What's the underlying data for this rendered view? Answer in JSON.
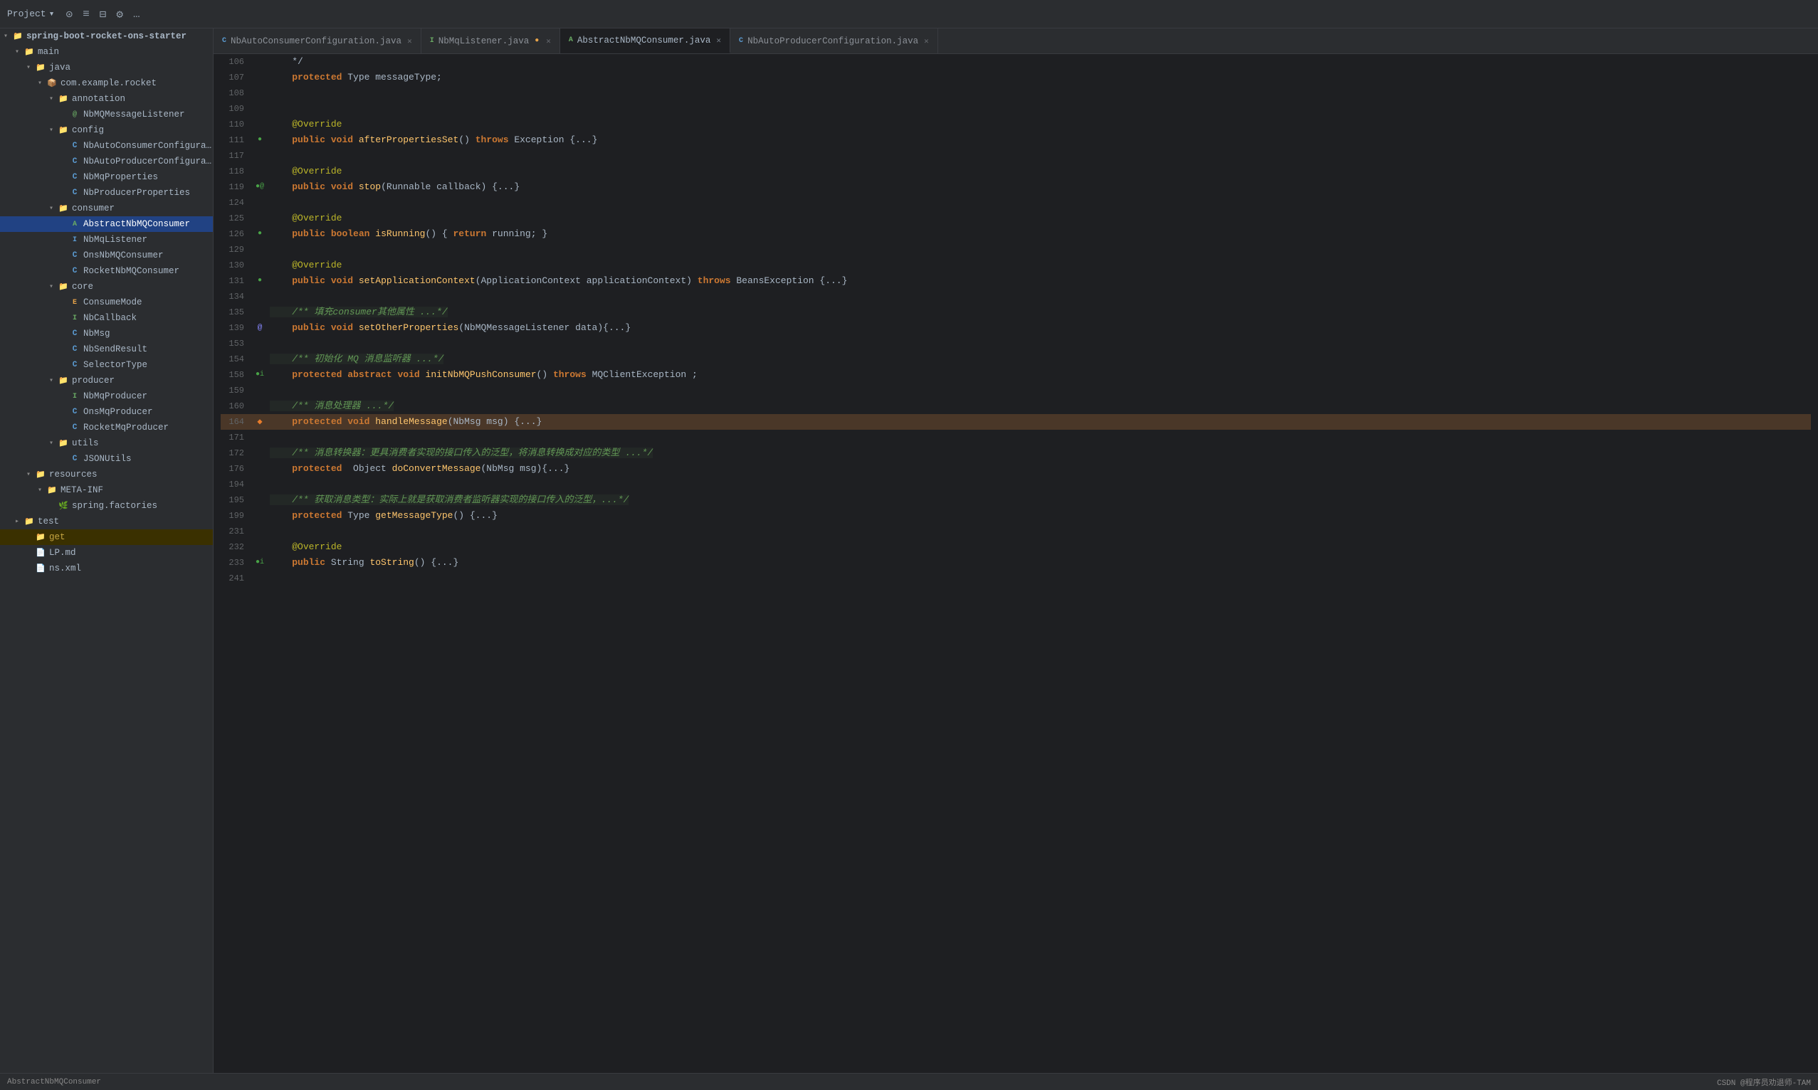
{
  "toolbar": {
    "project_label": "Project",
    "dropdown_arrow": "▾"
  },
  "tabs": [
    {
      "id": "tab1",
      "label": "NbAutoConsumerConfiguration.java",
      "active": false,
      "modified": false,
      "icon": "C"
    },
    {
      "id": "tab2",
      "label": "NbMqListener.java",
      "active": false,
      "modified": true,
      "icon": "I"
    },
    {
      "id": "tab3",
      "label": "AbstractNbMQConsumer.java",
      "active": true,
      "modified": false,
      "icon": "A"
    },
    {
      "id": "tab4",
      "label": "NbAutoProducerConfiguration.java",
      "active": false,
      "modified": false,
      "icon": "C"
    }
  ],
  "sidebar": {
    "root": "spring-boot-rocket-ons-starter",
    "items": [
      {
        "level": 0,
        "type": "dir",
        "label": "main",
        "expanded": true,
        "arrow": "▾"
      },
      {
        "level": 1,
        "type": "dir",
        "label": "java",
        "expanded": true,
        "arrow": "▾"
      },
      {
        "level": 2,
        "type": "package",
        "label": "com.example.rocket",
        "expanded": true,
        "arrow": "▾"
      },
      {
        "level": 3,
        "type": "dir",
        "label": "annotation",
        "expanded": true,
        "arrow": "▾"
      },
      {
        "level": 4,
        "type": "annotation",
        "label": "NbMQMessageListener",
        "arrow": ""
      },
      {
        "level": 3,
        "type": "dir",
        "label": "config",
        "expanded": true,
        "arrow": "▾"
      },
      {
        "level": 4,
        "type": "class",
        "label": "NbAutoConsumerConfiguration",
        "arrow": ""
      },
      {
        "level": 4,
        "type": "class",
        "label": "NbAutoProducerConfiguration",
        "arrow": ""
      },
      {
        "level": 4,
        "type": "class",
        "label": "NbMqProperties",
        "arrow": ""
      },
      {
        "level": 4,
        "type": "class",
        "label": "NbProducerProperties",
        "arrow": ""
      },
      {
        "level": 3,
        "type": "dir",
        "label": "consumer",
        "expanded": true,
        "arrow": "▾"
      },
      {
        "level": 4,
        "type": "abstract",
        "label": "AbstractNbMQConsumer",
        "selected": true,
        "arrow": ""
      },
      {
        "level": 4,
        "type": "interface",
        "label": "NbMqListener",
        "arrow": ""
      },
      {
        "level": 4,
        "type": "class",
        "label": "OnsNbMQConsumer",
        "arrow": ""
      },
      {
        "level": 4,
        "type": "class",
        "label": "RocketNbMQConsumer",
        "arrow": ""
      },
      {
        "level": 3,
        "type": "dir",
        "label": "core",
        "expanded": true,
        "arrow": "▾"
      },
      {
        "level": 4,
        "type": "enum",
        "label": "ConsumeMode",
        "arrow": ""
      },
      {
        "level": 4,
        "type": "interface",
        "label": "NbCallback",
        "arrow": ""
      },
      {
        "level": 4,
        "type": "class",
        "label": "NbMsg",
        "arrow": ""
      },
      {
        "level": 4,
        "type": "class",
        "label": "NbSendResult",
        "arrow": ""
      },
      {
        "level": 4,
        "type": "class",
        "label": "SelectorType",
        "arrow": ""
      },
      {
        "level": 3,
        "type": "dir",
        "label": "producer",
        "expanded": true,
        "arrow": "▾"
      },
      {
        "level": 4,
        "type": "interface",
        "label": "NbMqProducer",
        "arrow": ""
      },
      {
        "level": 4,
        "type": "class",
        "label": "OnsMqProducer",
        "arrow": ""
      },
      {
        "level": 4,
        "type": "class",
        "label": "RocketMqProducer",
        "arrow": ""
      },
      {
        "level": 3,
        "type": "dir",
        "label": "utils",
        "expanded": true,
        "arrow": "▾"
      },
      {
        "level": 4,
        "type": "class",
        "label": "JSONUtils",
        "arrow": ""
      },
      {
        "level": 1,
        "type": "dir",
        "label": "resources",
        "expanded": true,
        "arrow": "▾"
      },
      {
        "level": 2,
        "type": "dir",
        "label": "META-INF",
        "expanded": true,
        "arrow": "▾"
      },
      {
        "level": 3,
        "type": "spring",
        "label": "spring.factories",
        "arrow": ""
      },
      {
        "level": 0,
        "type": "dir",
        "label": "test",
        "expanded": false,
        "arrow": "▸"
      },
      {
        "level": 1,
        "type": "dir_active",
        "label": "get",
        "arrow": ""
      },
      {
        "level": 1,
        "type": "file",
        "label": "LP.md",
        "arrow": ""
      },
      {
        "level": 1,
        "type": "xml",
        "label": "ns.xml",
        "arrow": ""
      }
    ]
  },
  "code": {
    "lines": [
      {
        "num": "106",
        "marker": "",
        "code": "    */"
      },
      {
        "num": "107",
        "marker": "",
        "code": "    <kw>protected</kw> Type messageType;"
      },
      {
        "num": "108",
        "marker": "",
        "code": ""
      },
      {
        "num": "109",
        "marker": "",
        "code": ""
      },
      {
        "num": "110",
        "marker": "",
        "code": "    <annotation>@Override</annotation>"
      },
      {
        "num": "111",
        "marker": "●",
        "code": "    <kw>public</kw> <kw>void</kw> <method>afterPropertiesSet</method>() <kw>throws</kw> Exception {...}"
      },
      {
        "num": "117",
        "marker": "",
        "code": ""
      },
      {
        "num": "118",
        "marker": "",
        "code": "    <annotation>@Override</annotation>"
      },
      {
        "num": "119",
        "marker": "●@",
        "code": "    <kw>public</kw> <kw>void</kw> <method>stop</method>(Runnable callback) {...}"
      },
      {
        "num": "124",
        "marker": "",
        "code": ""
      },
      {
        "num": "125",
        "marker": "",
        "code": "    <annotation>@Override</annotation>"
      },
      {
        "num": "126",
        "marker": "●",
        "code": "    <kw>public</kw> <kw>boolean</kw> <method>isRunning</method>() { <kw>return</kw> running; }"
      },
      {
        "num": "129",
        "marker": "",
        "code": ""
      },
      {
        "num": "130",
        "marker": "",
        "code": "    <annotation>@Override</annotation>"
      },
      {
        "num": "131",
        "marker": "●",
        "code": "    <kw>public</kw> <kw>void</kw> <method>setApplicationContext</method>(ApplicationContext applicationContext) <kw>throws</kw> BeansException {...}"
      },
      {
        "num": "134",
        "marker": "",
        "code": ""
      },
      {
        "num": "135",
        "marker": "",
        "code": "    <comment>/** 填充consumer其他属性 ...*/</comment>"
      },
      {
        "num": "139",
        "marker": "@",
        "code": "    <kw>public</kw> <kw>void</kw> <method>setOtherProperties</method>(NbMQMessageListener data){...}"
      },
      {
        "num": "153",
        "marker": "",
        "code": ""
      },
      {
        "num": "154",
        "marker": "",
        "code": "    <comment>/** 初始化 MQ 消息监听器 ...*/</comment>"
      },
      {
        "num": "158",
        "marker": "●i",
        "code": "    <kw>protected</kw> <kw>abstract</kw> <kw>void</kw> <method>initNbMQPushConsumer</method>() <kw>throws</kw> MQClientException ;"
      },
      {
        "num": "159",
        "marker": "",
        "code": ""
      },
      {
        "num": "160",
        "marker": "",
        "code": "    <comment>/** 消息处理器 ...*/</comment>"
      },
      {
        "num": "164",
        "marker": "◆",
        "code": "    <kw>protected</kw> <kw>void</kw> <method>handleMessage</method>(NbMsg msg) {...}",
        "highlighted": true
      },
      {
        "num": "171",
        "marker": "",
        "code": ""
      },
      {
        "num": "172",
        "marker": "",
        "code": "    <comment>/** 消息转换器：更具消费者实现的接口传入的泛型，将消息转换成对应的类型 ...*/</comment>"
      },
      {
        "num": "176",
        "marker": "",
        "code": "    <kw>protected</kw>  Object <method>doConvertMessage</method>(NbMsg msg){...}"
      },
      {
        "num": "194",
        "marker": "",
        "code": ""
      },
      {
        "num": "195",
        "marker": "",
        "code": "    <comment>/** 获取消息类型：实际上就是获取消费者监听器实现的接口传入的泛型，...*/</comment>"
      },
      {
        "num": "199",
        "marker": "",
        "code": "    <kw>protected</kw> Type <method>getMessageType</method>() {...}"
      },
      {
        "num": "231",
        "marker": "",
        "code": ""
      },
      {
        "num": "232",
        "marker": "",
        "code": "    <annotation>@Override</annotation>"
      },
      {
        "num": "233",
        "marker": "●i",
        "code": "    <kw>public</kw> String <method>toString</method>() {...}"
      },
      {
        "num": "241",
        "marker": "",
        "code": ""
      }
    ]
  },
  "bottom_bar": {
    "left": "AbstractNbMQConsumer",
    "right": "CSDN @程序员劝退师-TAM"
  }
}
